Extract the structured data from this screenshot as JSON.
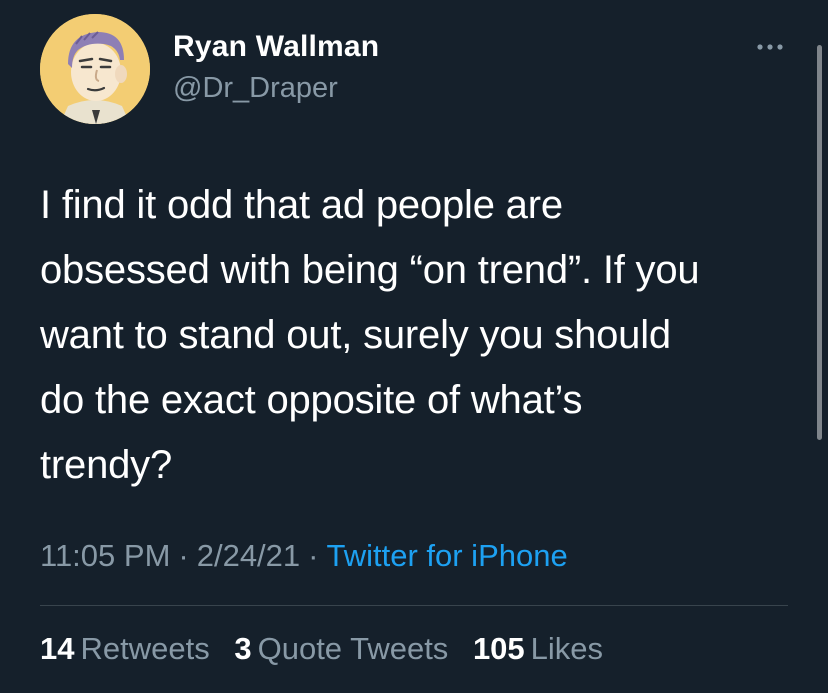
{
  "author": {
    "display_name": "Ryan Wallman",
    "handle": "@Dr_Draper"
  },
  "tweet": {
    "text_lines": [
      "I find it odd that ad people are",
      "obsessed with being “on trend”. If you",
      "want to stand out, surely you should",
      "do the exact opposite of what’s",
      "trendy?"
    ],
    "time": "11:05 PM",
    "separator": "·",
    "date": "2/24/21",
    "source": "Twitter for iPhone"
  },
  "stats": {
    "retweets": {
      "count": "14",
      "label": "Retweets"
    },
    "quote_tweets": {
      "count": "3",
      "label": "Quote Tweets"
    },
    "likes": {
      "count": "105",
      "label": "Likes"
    }
  },
  "icons": {
    "more": "more-horizontal-icon"
  },
  "colors": {
    "background": "#15202b",
    "primary_text": "#ffffff",
    "secondary_text": "#8899a6",
    "link": "#1da1f2",
    "divider": "#38444d"
  }
}
